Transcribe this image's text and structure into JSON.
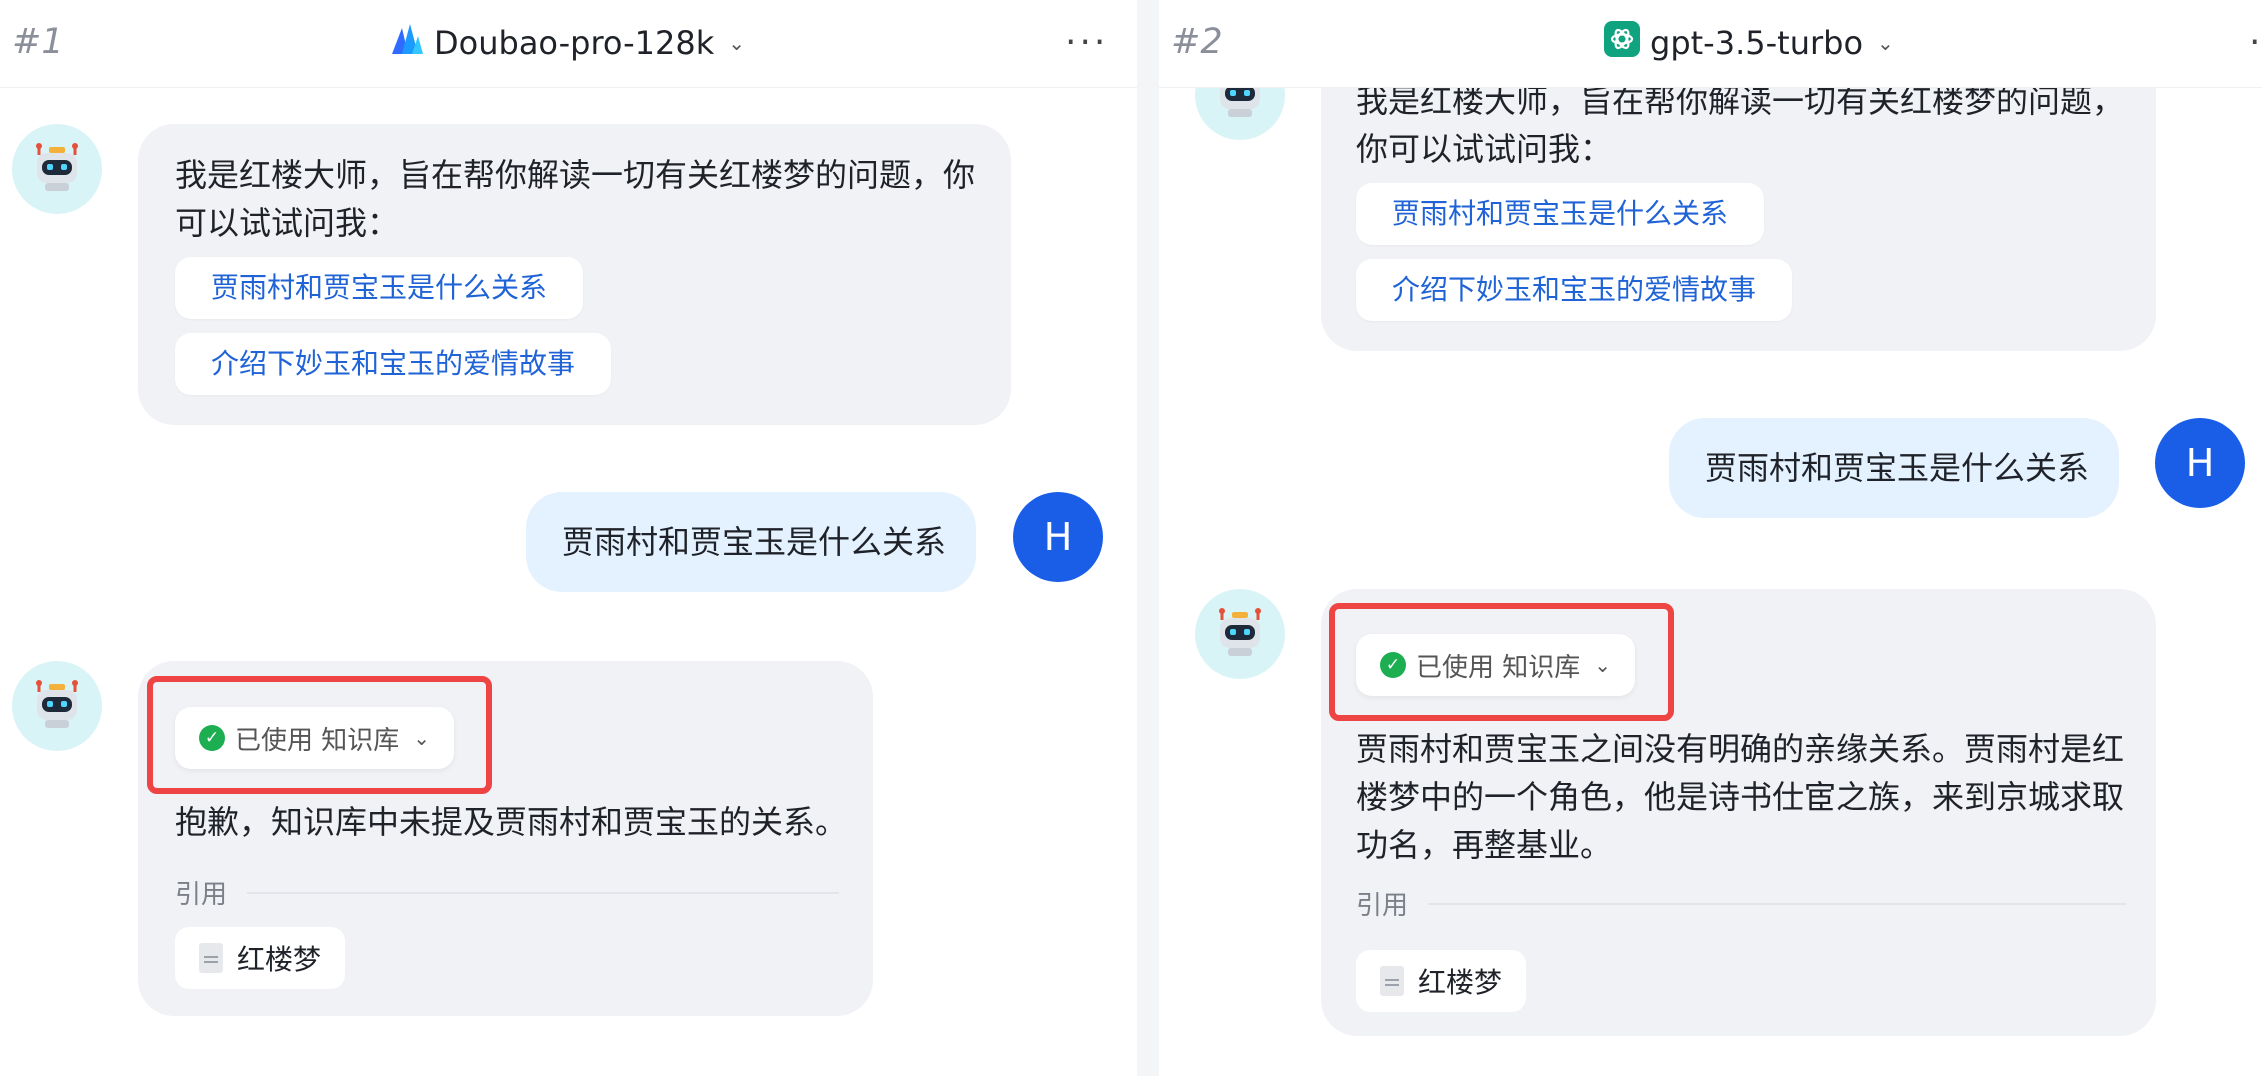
{
  "panels": [
    {
      "number": "#1",
      "model": "Doubao-pro-128k",
      "bot_intro": "我是红楼大师，旨在帮你解读一切有关红楼梦的问题，你可以试试问我：",
      "suggestions": [
        "贾雨村和贾宝玉是什么关系",
        "介绍下妙玉和宝玉的爱情故事"
      ],
      "user_avatar": "H",
      "user_message": "贾雨村和贾宝玉是什么关系",
      "kb_label": "已使用 知识库",
      "answer": "抱歉，知识库中未提及贾雨村和贾宝玉的关系。",
      "ref_label": "引用",
      "ref_doc": "红楼梦"
    },
    {
      "number": "#2",
      "model": "gpt-3.5-turbo",
      "bot_intro": "我是红楼大师，旨在帮你解读一切有关红楼梦的问题，你可以试试问我：",
      "suggestions": [
        "贾雨村和贾宝玉是什么关系",
        "介绍下妙玉和宝玉的爱情故事"
      ],
      "user_avatar": "H",
      "user_message": "贾雨村和贾宝玉是什么关系",
      "kb_label": "已使用 知识库",
      "answer": "贾雨村和贾宝玉之间没有明确的亲缘关系。贾雨村是红楼梦中的一个角色，他是诗书仕宦之族，来到京城求取功名，再整基业。",
      "ref_label": "引用",
      "ref_doc": "红楼梦"
    }
  ],
  "icons": {
    "more": "more-icon",
    "bot_avatar": "robot-icon",
    "doubao_logo": "doubao-logo-icon",
    "openai_logo": "openai-logo-icon",
    "check": "check-circle-icon",
    "doc": "document-icon"
  },
  "colors": {
    "link": "#1f63d6",
    "user_avatar": "#1a5ee8",
    "highlight": "#ee4444",
    "check": "#1dae52",
    "openai_brand": "#10a37f"
  }
}
